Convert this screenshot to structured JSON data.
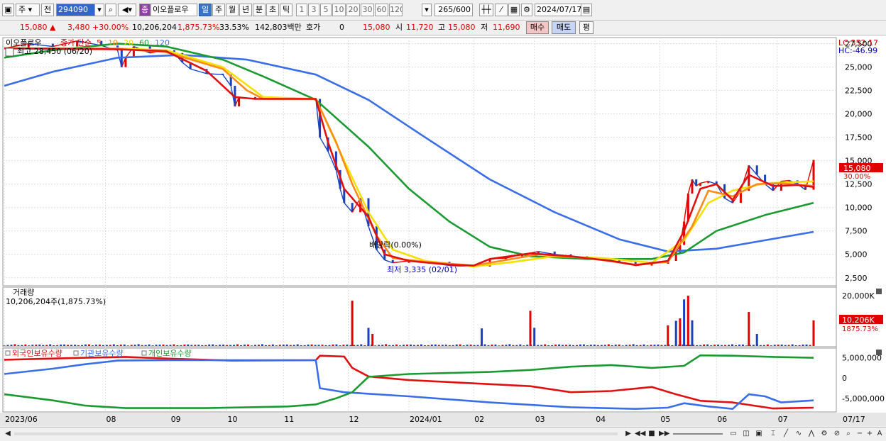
{
  "toolbar": {
    "market": "주",
    "compare": "전",
    "code": "294090",
    "badge": "종",
    "name": "이오플로우",
    "periods": [
      "일",
      "주",
      "월",
      "년",
      "분",
      "초",
      "틱"
    ],
    "selected_period": "일",
    "intervals": [
      "1",
      "3",
      "5",
      "10",
      "20",
      "30",
      "60",
      "120"
    ],
    "count": "265",
    "count_total": "/600",
    "date": "2024/07/17"
  },
  "quote": {
    "price": "15,080",
    "change": "3,480",
    "change_pct": "+30.00%",
    "volume": "10,206,204",
    "volume_pct": "1,875.73%",
    "turnover": "33.53%",
    "amount": "142,803백만",
    "hoga_label": "호가",
    "hoga_value": "0",
    "hoga_price": "15,080",
    "open_label": "시",
    "open": "11,720",
    "high_label": "고",
    "high": "15,080",
    "low_label": "저",
    "low": "11,690",
    "buy": "매수",
    "sell": "매도",
    "eval": "평"
  },
  "price_panel": {
    "legend_name": "이오플로우",
    "legend_kind": "종가 단순",
    "ma_labels": [
      "5",
      "10",
      "20",
      "60",
      "120"
    ],
    "ma_colors": [
      "#e01010",
      "#ff8c1a",
      "#f5e000",
      "#1a9a30",
      "#3a6ee8"
    ],
    "high_note": "최고 28,450 (06/20)",
    "low_note": "최저 3,335 (02/01)",
    "dividend_note": "배당락(0.00%)",
    "lc": "LC:352.17",
    "hc": "HC:-46.99",
    "last_tag": "15,080",
    "last_pct": "30.00%"
  },
  "volume_panel": {
    "title": "거래량",
    "info": "10,206,204주(1,875.73%)",
    "last_tag": "10,206K",
    "last_pct": "1875.73%",
    "max_label": "20,000K"
  },
  "holding_panel": {
    "legend": [
      "외국인보유수량",
      "기관보유수량",
      "개인보유수량"
    ],
    "colors": [
      "#e01010",
      "#3a6ee8",
      "#1a9a30"
    ],
    "axis_ticks": [
      "5,000,000",
      "0",
      "-5,000,000"
    ]
  },
  "x_labels": [
    "2023/06",
    "08",
    "09",
    "10",
    "11",
    "12",
    "2024/01",
    "02",
    "03",
    "04",
    "05",
    "06",
    "07",
    "07/17"
  ],
  "chart_data": {
    "type": "candlestick",
    "title": "이오플로우",
    "y_ticks": [
      27500,
      25000,
      22500,
      20000,
      17500,
      15000,
      12500,
      10000,
      7500,
      5000,
      2500
    ],
    "ylim": [
      1800,
      28000
    ],
    "x_months": [
      {
        "label": "2023/06",
        "x": 0
      },
      {
        "label": "08",
        "x": 0.125
      },
      {
        "label": "09",
        "x": 0.205
      },
      {
        "label": "10",
        "x": 0.275
      },
      {
        "label": "11",
        "x": 0.345
      },
      {
        "label": "12",
        "x": 0.425
      },
      {
        "label": "2024/01",
        "x": 0.5
      },
      {
        "label": "02",
        "x": 0.58
      },
      {
        "label": "03",
        "x": 0.655
      },
      {
        "label": "04",
        "x": 0.73
      },
      {
        "label": "05",
        "x": 0.81
      },
      {
        "label": "06",
        "x": 0.88
      },
      {
        "label": "07",
        "x": 0.955
      }
    ],
    "close_points": [
      [
        0.0,
        27000
      ],
      [
        0.03,
        27500
      ],
      [
        0.06,
        27200
      ],
      [
        0.09,
        27800
      ],
      [
        0.12,
        27300
      ],
      [
        0.14,
        26800
      ],
      [
        0.145,
        25000
      ],
      [
        0.15,
        26000
      ],
      [
        0.16,
        27200
      ],
      [
        0.18,
        26500
      ],
      [
        0.2,
        26800
      ],
      [
        0.21,
        26500
      ],
      [
        0.22,
        25500
      ],
      [
        0.23,
        24800
      ],
      [
        0.25,
        24300
      ],
      [
        0.27,
        24200
      ],
      [
        0.28,
        23000
      ],
      [
        0.285,
        20800
      ],
      [
        0.29,
        21800
      ],
      [
        0.31,
        21600
      ],
      [
        0.385,
        21600
      ],
      [
        0.39,
        17500
      ],
      [
        0.4,
        16000
      ],
      [
        0.41,
        14000
      ],
      [
        0.415,
        12000
      ],
      [
        0.42,
        10500
      ],
      [
        0.43,
        9500
      ],
      [
        0.44,
        11000
      ],
      [
        0.45,
        8000
      ],
      [
        0.46,
        5500
      ],
      [
        0.47,
        4400
      ],
      [
        0.48,
        4100
      ],
      [
        0.5,
        4300
      ],
      [
        0.52,
        4200
      ],
      [
        0.55,
        3800
      ],
      [
        0.58,
        3700
      ],
      [
        0.6,
        4500
      ],
      [
        0.62,
        4600
      ],
      [
        0.64,
        5000
      ],
      [
        0.66,
        5300
      ],
      [
        0.68,
        5000
      ],
      [
        0.7,
        4800
      ],
      [
        0.72,
        4600
      ],
      [
        0.74,
        4500
      ],
      [
        0.76,
        4200
      ],
      [
        0.78,
        3800
      ],
      [
        0.8,
        4000
      ],
      [
        0.82,
        4300
      ],
      [
        0.83,
        5200
      ],
      [
        0.835,
        6000
      ],
      [
        0.84,
        8500
      ],
      [
        0.845,
        11500
      ],
      [
        0.85,
        13000
      ],
      [
        0.855,
        12300
      ],
      [
        0.86,
        12600
      ],
      [
        0.87,
        12800
      ],
      [
        0.88,
        12500
      ],
      [
        0.89,
        11000
      ],
      [
        0.9,
        10500
      ],
      [
        0.91,
        11800
      ],
      [
        0.92,
        14500
      ],
      [
        0.93,
        13500
      ],
      [
        0.94,
        12500
      ],
      [
        0.95,
        11800
      ],
      [
        0.96,
        12800
      ],
      [
        0.97,
        12900
      ],
      [
        0.98,
        12500
      ],
      [
        0.99,
        11900
      ],
      [
        1.0,
        15080
      ]
    ],
    "series": [
      {
        "name": "5",
        "points": [
          [
            0,
            27000
          ],
          [
            0.14,
            26900
          ],
          [
            0.2,
            26700
          ],
          [
            0.25,
            24600
          ],
          [
            0.285,
            21800
          ],
          [
            0.31,
            21600
          ],
          [
            0.385,
            21600
          ],
          [
            0.4,
            17000
          ],
          [
            0.42,
            12000
          ],
          [
            0.45,
            9000
          ],
          [
            0.47,
            5000
          ],
          [
            0.5,
            4300
          ],
          [
            0.55,
            3900
          ],
          [
            0.58,
            3800
          ],
          [
            0.6,
            4500
          ],
          [
            0.65,
            5100
          ],
          [
            0.7,
            4800
          ],
          [
            0.75,
            4300
          ],
          [
            0.78,
            3850
          ],
          [
            0.82,
            4300
          ],
          [
            0.84,
            7500
          ],
          [
            0.86,
            12000
          ],
          [
            0.88,
            12500
          ],
          [
            0.9,
            10800
          ],
          [
            0.92,
            13500
          ],
          [
            0.95,
            12300
          ],
          [
            0.98,
            12400
          ],
          [
            1.0,
            12200
          ]
        ]
      },
      {
        "name": "10",
        "points": [
          [
            0,
            27000
          ],
          [
            0.14,
            26950
          ],
          [
            0.2,
            26600
          ],
          [
            0.27,
            24800
          ],
          [
            0.3,
            22500
          ],
          [
            0.32,
            21600
          ],
          [
            0.385,
            21600
          ],
          [
            0.41,
            17000
          ],
          [
            0.43,
            12500
          ],
          [
            0.46,
            7000
          ],
          [
            0.48,
            4600
          ],
          [
            0.52,
            4200
          ],
          [
            0.58,
            3800
          ],
          [
            0.62,
            4400
          ],
          [
            0.66,
            5000
          ],
          [
            0.72,
            4600
          ],
          [
            0.78,
            3900
          ],
          [
            0.82,
            4200
          ],
          [
            0.85,
            8000
          ],
          [
            0.87,
            11800
          ],
          [
            0.9,
            11200
          ],
          [
            0.93,
            12500
          ],
          [
            0.96,
            12600
          ],
          [
            1.0,
            12300
          ]
        ]
      },
      {
        "name": "20",
        "points": [
          [
            0,
            27000
          ],
          [
            0.14,
            27000
          ],
          [
            0.2,
            26800
          ],
          [
            0.27,
            25000
          ],
          [
            0.32,
            21800
          ],
          [
            0.385,
            21600
          ],
          [
            0.42,
            15000
          ],
          [
            0.45,
            9500
          ],
          [
            0.48,
            5500
          ],
          [
            0.52,
            4300
          ],
          [
            0.58,
            3700
          ],
          [
            0.63,
            4200
          ],
          [
            0.68,
            4800
          ],
          [
            0.74,
            4600
          ],
          [
            0.8,
            4100
          ],
          [
            0.84,
            6500
          ],
          [
            0.87,
            10500
          ],
          [
            0.9,
            11800
          ],
          [
            0.94,
            12600
          ],
          [
            1.0,
            12800
          ]
        ]
      },
      {
        "name": "60",
        "points": [
          [
            0,
            26000
          ],
          [
            0.06,
            26800
          ],
          [
            0.14,
            27500
          ],
          [
            0.2,
            27200
          ],
          [
            0.27,
            25800
          ],
          [
            0.32,
            24000
          ],
          [
            0.385,
            21500
          ],
          [
            0.45,
            16500
          ],
          [
            0.5,
            12000
          ],
          [
            0.55,
            8500
          ],
          [
            0.6,
            5800
          ],
          [
            0.65,
            4800
          ],
          [
            0.72,
            4500
          ],
          [
            0.8,
            4500
          ],
          [
            0.84,
            5200
          ],
          [
            0.88,
            7500
          ],
          [
            0.94,
            9200
          ],
          [
            1.0,
            10500
          ]
        ]
      },
      {
        "name": "120",
        "points": [
          [
            0,
            23000
          ],
          [
            0.06,
            24500
          ],
          [
            0.14,
            26000
          ],
          [
            0.22,
            26300
          ],
          [
            0.3,
            25800
          ],
          [
            0.385,
            24200
          ],
          [
            0.45,
            21500
          ],
          [
            0.52,
            17500
          ],
          [
            0.6,
            13000
          ],
          [
            0.68,
            9500
          ],
          [
            0.76,
            6600
          ],
          [
            0.82,
            5300
          ],
          [
            0.88,
            5600
          ],
          [
            0.94,
            6500
          ],
          [
            1.0,
            7400
          ]
        ]
      }
    ],
    "volume_max": 20000,
    "volume_spikes": [
      [
        0.43,
        18000
      ],
      [
        0.45,
        7200
      ],
      [
        0.455,
        4800
      ],
      [
        0.59,
        7000
      ],
      [
        0.65,
        14000
      ],
      [
        0.655,
        7200
      ],
      [
        0.82,
        8200
      ],
      [
        0.83,
        10000
      ],
      [
        0.835,
        11000
      ],
      [
        0.84,
        18500
      ],
      [
        0.845,
        20000
      ],
      [
        0.85,
        10200
      ],
      [
        0.92,
        13500
      ],
      [
        0.93,
        4800
      ],
      [
        1.0,
        10206
      ]
    ],
    "holdings": {
      "foreign": [
        [
          0,
          4500
        ],
        [
          0.1,
          5000
        ],
        [
          0.15,
          5200
        ],
        [
          0.2,
          4800
        ],
        [
          0.28,
          4300
        ],
        [
          0.385,
          4400
        ],
        [
          0.39,
          5500
        ],
        [
          0.42,
          5300
        ],
        [
          0.43,
          2500
        ],
        [
          0.45,
          400
        ],
        [
          0.5,
          -500
        ],
        [
          0.6,
          -1500
        ],
        [
          0.65,
          -2000
        ],
        [
          0.7,
          -3500
        ],
        [
          0.75,
          -3200
        ],
        [
          0.8,
          -2200
        ],
        [
          0.83,
          -4000
        ],
        [
          0.86,
          -5600
        ],
        [
          0.9,
          -6000
        ],
        [
          0.95,
          -7500
        ],
        [
          1.0,
          -7300
        ]
      ],
      "institution": [
        [
          0,
          1000
        ],
        [
          0.06,
          2300
        ],
        [
          0.1,
          3400
        ],
        [
          0.14,
          4300
        ],
        [
          0.2,
          4400
        ],
        [
          0.385,
          4400
        ],
        [
          0.39,
          -2500
        ],
        [
          0.42,
          -3500
        ],
        [
          0.5,
          -4500
        ],
        [
          0.6,
          -6000
        ],
        [
          0.7,
          -7200
        ],
        [
          0.78,
          -7600
        ],
        [
          0.82,
          -7300
        ],
        [
          0.84,
          -6200
        ],
        [
          0.87,
          -7000
        ],
        [
          0.9,
          -7600
        ],
        [
          0.92,
          -4000
        ],
        [
          0.94,
          -4500
        ],
        [
          0.96,
          -6000
        ],
        [
          1.0,
          -5500
        ]
      ],
      "individual": [
        [
          0,
          -4000
        ],
        [
          0.06,
          -5500
        ],
        [
          0.1,
          -6800
        ],
        [
          0.15,
          -7400
        ],
        [
          0.25,
          -7400
        ],
        [
          0.35,
          -7000
        ],
        [
          0.385,
          -6500
        ],
        [
          0.41,
          -5000
        ],
        [
          0.43,
          -3500
        ],
        [
          0.45,
          300
        ],
        [
          0.5,
          1000
        ],
        [
          0.6,
          1500
        ],
        [
          0.65,
          2000
        ],
        [
          0.7,
          2800
        ],
        [
          0.75,
          3200
        ],
        [
          0.8,
          2500
        ],
        [
          0.84,
          3000
        ],
        [
          0.86,
          5600
        ],
        [
          0.9,
          5500
        ],
        [
          0.95,
          5200
        ],
        [
          1.0,
          5000
        ]
      ]
    },
    "holding_range": [
      -8000,
      6500
    ]
  }
}
